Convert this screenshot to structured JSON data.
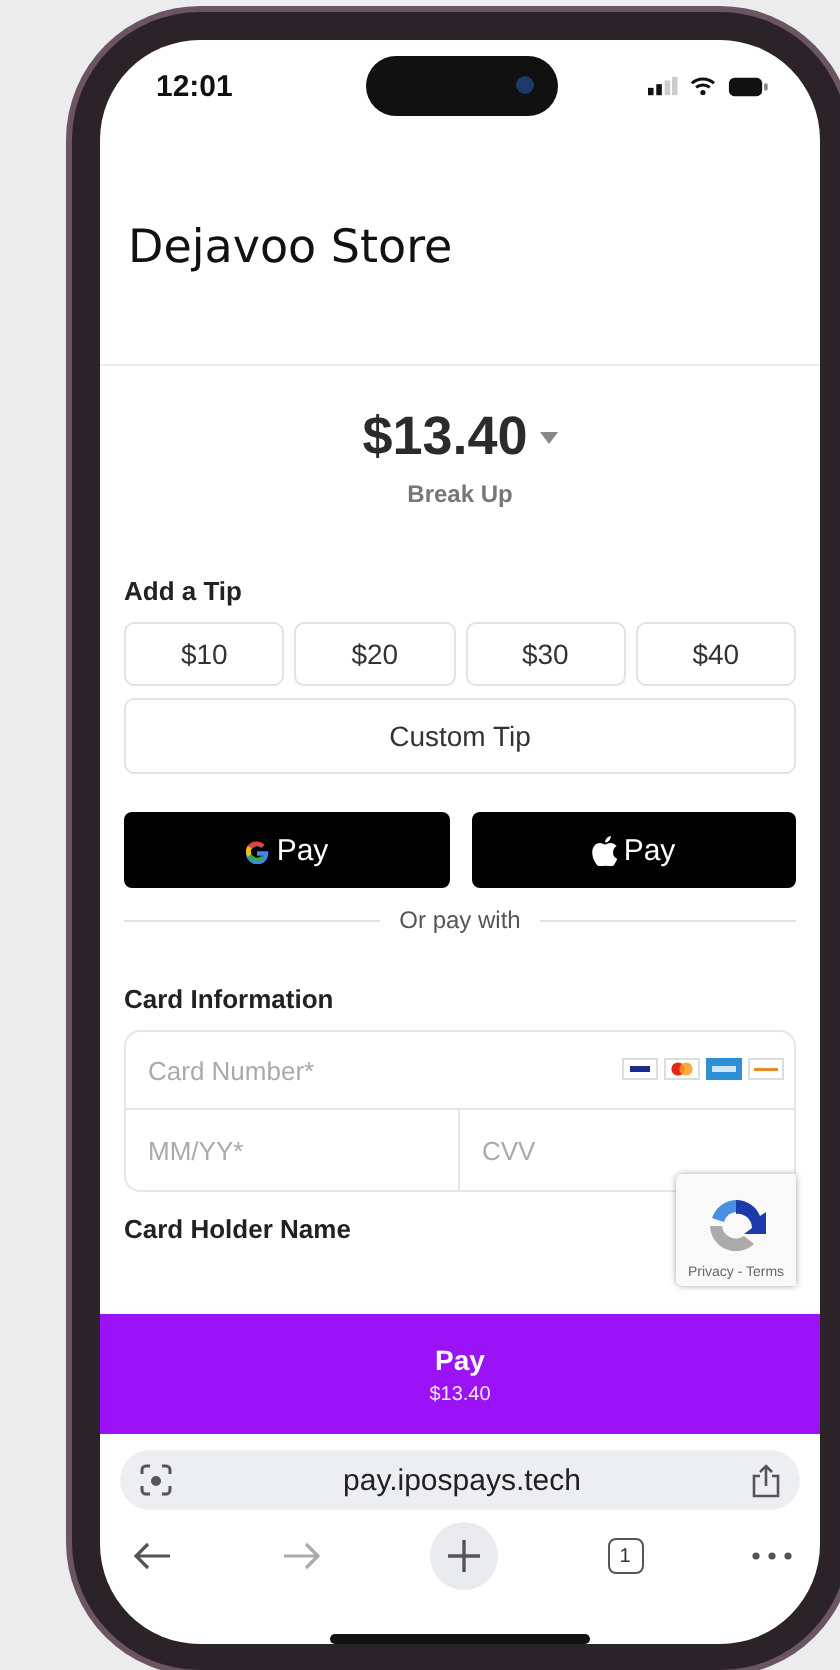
{
  "status_bar": {
    "time": "12:01"
  },
  "store": {
    "title": "Dejavoo Store"
  },
  "amount": {
    "total": "$13.40",
    "breakdown_link": "Break Up"
  },
  "tip": {
    "label": "Add a Tip",
    "options": [
      {
        "label": "$10",
        "selected": false
      },
      {
        "label": "$20",
        "selected": false
      },
      {
        "label": "$30",
        "selected": false
      },
      {
        "label": "$40",
        "selected": false
      }
    ],
    "custom": "Custom Tip"
  },
  "wallets": [
    {
      "kind": "google",
      "label": "Pay"
    },
    {
      "kind": "apple",
      "label": "Pay"
    }
  ],
  "divider_text": "Or pay with",
  "card": {
    "label": "Card Information",
    "number_placeholder": "Card Number*",
    "expiry_placeholder": "MM/YY*",
    "cvv_placeholder": "CVV"
  },
  "holder": {
    "label": "Card Holder Name"
  },
  "recaptcha": {
    "links": "Privacy - Terms"
  },
  "pay_button": {
    "label": "Pay",
    "amount": "$13.40"
  },
  "browser": {
    "url": "pay.ipospays.tech",
    "tab_count": "1"
  }
}
